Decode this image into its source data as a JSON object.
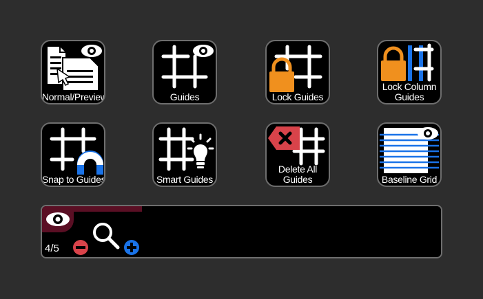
{
  "buttons": [
    {
      "id": "normal-preview",
      "label": "Normal/Preview",
      "icon": "document-eye-icon"
    },
    {
      "id": "guides",
      "label": "Guides",
      "icon": "grid-eye-icon"
    },
    {
      "id": "lock-guides",
      "label": "Lock Guides",
      "icon": "grid-lock-icon"
    },
    {
      "id": "lock-column-guides",
      "label_line1": "Lock Column",
      "label_line2": "Guides",
      "icon": "column-lock-icon"
    },
    {
      "id": "snap-to-guides",
      "label": "Snap to Guides",
      "icon": "grid-magnet-icon"
    },
    {
      "id": "smart-guides",
      "label": "Smart Guides",
      "icon": "grid-lightbulb-icon"
    },
    {
      "id": "delete-all-guides",
      "label_line1": "Delete All",
      "label_line2": "Guides",
      "icon": "grid-delete-icon"
    },
    {
      "id": "baseline-grid",
      "label": "Baseline Grid",
      "icon": "baseline-eye-icon"
    }
  ],
  "zoom_panel": {
    "page_count": "4/5",
    "progress_fraction": 0.25,
    "icons": [
      "eye-icon",
      "zoom-out-icon",
      "magnifier-icon",
      "zoom-in-icon"
    ]
  },
  "colors": {
    "background": "#2d2d2d",
    "button_bg": "#000000",
    "border": "#6e6e6e",
    "lock_orange": "#f0901e",
    "accent_blue": "#1a73e8",
    "delete_red": "#d9434a",
    "zoom_out_red": "#d9434a",
    "zoom_in_blue": "#1a73e8",
    "tab_maroon": "#5a0f24"
  }
}
